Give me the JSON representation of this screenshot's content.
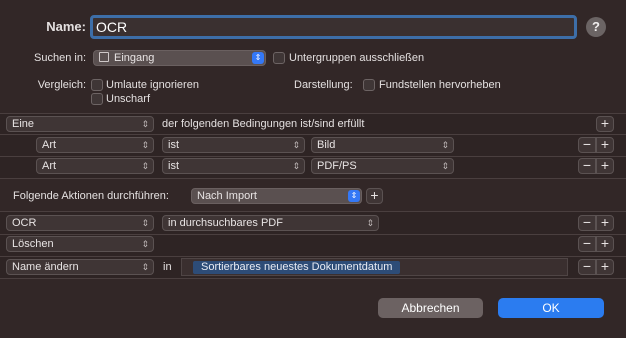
{
  "name_label": "Name:",
  "name_value": "OCR",
  "help_label": "?",
  "search_in_label": "Suchen in:",
  "search_in_value": "Eingang",
  "exclude_subgroups_label": "Untergruppen ausschließen",
  "compare_label": "Vergleich:",
  "ignore_umlauts_label": "Umlaute ignorieren",
  "fuzzy_label": "Unscharf",
  "display_label": "Darstellung:",
  "highlight_label": "Fundstellen hervorheben",
  "match_select": "Eine",
  "match_text": "der folgenden Bedingungen ist/sind erfüllt",
  "conditions": [
    {
      "field": "Art",
      "op": "ist",
      "value": "Bild"
    },
    {
      "field": "Art",
      "op": "ist",
      "value": "PDF/PS"
    }
  ],
  "actions_label": "Folgende Aktionen durchführen:",
  "actions_trigger": "Nach Import",
  "actions": [
    {
      "action": "OCR",
      "option": "in durchsuchbares PDF"
    },
    {
      "action": "Löschen"
    },
    {
      "action": "Name ändern",
      "in_label": "in",
      "token": "Sortierbares neuestes Dokumentdatum"
    }
  ],
  "cancel_label": "Abbrechen",
  "ok_label": "OK",
  "icons": {
    "chevron": "⌃⌄",
    "plus": "+",
    "minus": "−"
  }
}
